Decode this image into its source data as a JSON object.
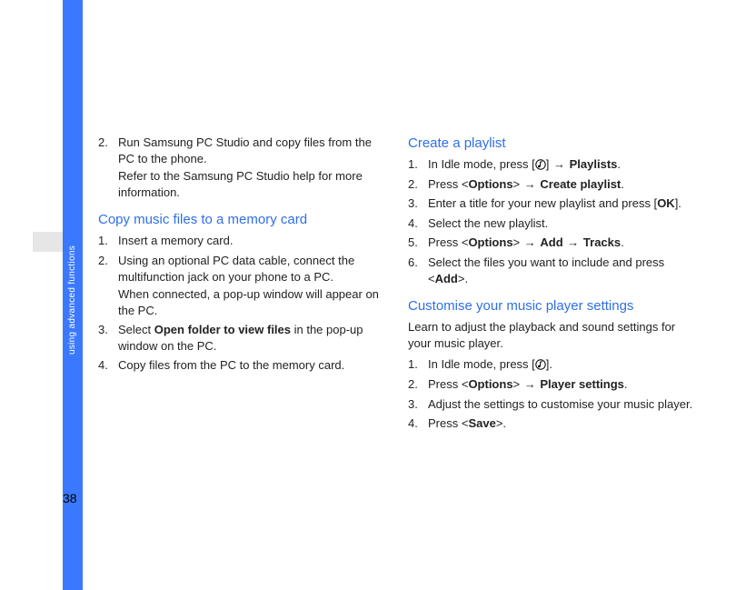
{
  "page_number": "38",
  "side_label": "using advanced functions",
  "glyphs": {
    "arrow": "→"
  },
  "left": {
    "pre_step": {
      "num": "2.",
      "line1_a": "Run Samsung PC Studio and copy files from the PC to the phone.",
      "line2": "Refer to the Samsung PC Studio help for more information."
    },
    "heading1": "Copy music files to a memory card",
    "steps1": [
      {
        "num": "1.",
        "text": "Insert a memory card."
      },
      {
        "num": "2.",
        "text": "Using an optional PC data cable, connect the multifunction jack on your phone to a PC.",
        "sub": "When connected, a pop-up window will appear on the PC."
      },
      {
        "num": "3.",
        "pre": "Select ",
        "bold": "Open folder to view files",
        "post": " in the pop-up window on the PC."
      },
      {
        "num": "4.",
        "text": "Copy files from the PC to the memory card."
      }
    ]
  },
  "right": {
    "heading1": "Create a playlist",
    "steps1": [
      {
        "num": "1.",
        "pre": "In Idle mode, press [",
        "icon": "music",
        "mid": "] ",
        "arrow": true,
        "bold": "Playlists",
        "post": "."
      },
      {
        "num": "2.",
        "pre": "Press <",
        "bold": "Options",
        "mid": "> ",
        "arrow": true,
        "bold2": "Create playlist",
        "post": "."
      },
      {
        "num": "3.",
        "pre": "Enter a title for your new playlist and press [",
        "bold": "OK",
        "post": "]."
      },
      {
        "num": "4.",
        "text": "Select the new playlist."
      },
      {
        "num": "5.",
        "pre": "Press <",
        "bold": "Options",
        "mid": "> ",
        "arrow": true,
        "bold2": "Add",
        "mid2": " ",
        "arrow2": true,
        "bold3": "Tracks",
        "post": "."
      },
      {
        "num": "6.",
        "pre": "Select the files you want to include and press <",
        "bold": "Add",
        "post": ">."
      }
    ],
    "heading2": "Customise your music player settings",
    "intro2": "Learn to adjust the playback and sound settings for your music player.",
    "steps2": [
      {
        "num": "1.",
        "pre": "In Idle mode, press [",
        "icon": "music",
        "post": "]."
      },
      {
        "num": "2.",
        "pre": "Press <",
        "bold": "Options",
        "mid": "> ",
        "arrow": true,
        "bold2": "Player settings",
        "post": "."
      },
      {
        "num": "3.",
        "text": "Adjust the settings to customise your music player."
      },
      {
        "num": "4.",
        "pre": "Press <",
        "bold": "Save",
        "post": ">."
      }
    ]
  }
}
